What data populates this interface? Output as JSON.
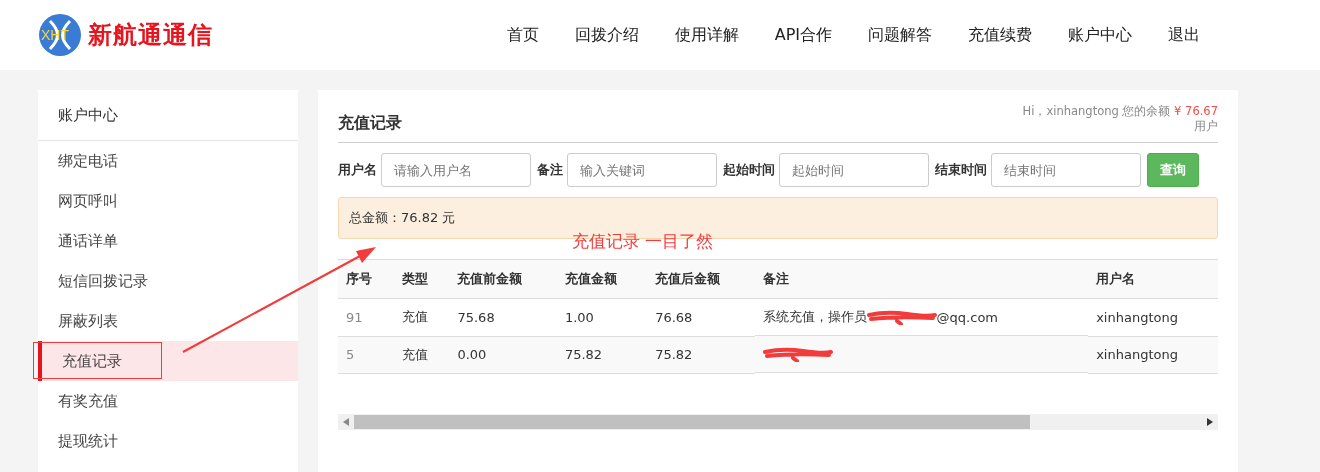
{
  "logo": {
    "mark": "XHT",
    "name": "新航通通信"
  },
  "nav": [
    {
      "label": "首页"
    },
    {
      "label": "回拨介绍"
    },
    {
      "label": "使用详解"
    },
    {
      "label": "API合作"
    },
    {
      "label": "问题解答"
    },
    {
      "label": "充值续费"
    },
    {
      "label": "账户中心"
    },
    {
      "label": "退出"
    }
  ],
  "sidebar": {
    "title": "账户中心",
    "items": [
      {
        "label": "绑定电话",
        "selected": false
      },
      {
        "label": "网页呼叫",
        "selected": false
      },
      {
        "label": "通话详单",
        "selected": false
      },
      {
        "label": "短信回拨记录",
        "selected": false
      },
      {
        "label": "屏蔽列表",
        "selected": false
      },
      {
        "label": "充值记录",
        "selected": true
      },
      {
        "label": "有奖充值",
        "selected": false
      },
      {
        "label": "提现统计",
        "selected": false
      }
    ]
  },
  "main": {
    "title": "充值记录",
    "greeting": "Hi，xinhangtong 您的余额",
    "balance": "¥ 76.67",
    "balance_suffix": "用户",
    "filters": [
      {
        "label": "用户名",
        "placeholder": "请输入用户名"
      },
      {
        "label": "备注",
        "placeholder": "输入关键词"
      },
      {
        "label": "起始时间",
        "placeholder": "起始时间"
      },
      {
        "label": "结束时间",
        "placeholder": "结束时间"
      }
    ],
    "search_button": "查询",
    "summary": "总金额：76.82 元",
    "table": {
      "columns": [
        "序号",
        "类型",
        "充值前金额",
        "充值金额",
        "充值后金额",
        "备注",
        "用户名"
      ],
      "rows": [
        {
          "cells": [
            "91",
            "充值",
            "75.68",
            "1.00",
            "76.68"
          ],
          "note": [
            {
              "kind": "text",
              "text": "系统充值，操作员"
            },
            {
              "kind": "redacted"
            },
            {
              "kind": "text",
              "text": "@qq.com"
            }
          ],
          "user": "xinhangtong"
        },
        {
          "cells": [
            "5",
            "充值",
            "0.00",
            "75.82",
            "75.82"
          ],
          "note": [
            {
              "kind": "redacted"
            }
          ],
          "user": "xinhangtong"
        }
      ]
    }
  },
  "annotation": {
    "text": "充值记录 一目了然"
  }
}
